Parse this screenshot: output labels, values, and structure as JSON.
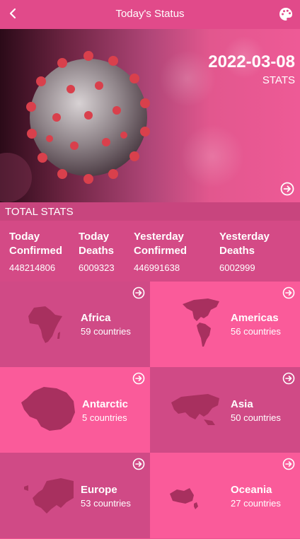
{
  "header": {
    "title": "Today's Status"
  },
  "hero": {
    "date": "2022-03-08",
    "subtitle": "STATS"
  },
  "section": {
    "title": "TOTAL STATS"
  },
  "totals": [
    {
      "label_line1": "Today",
      "label_line2": "Confirmed",
      "value": "448214806"
    },
    {
      "label_line1": "Today",
      "label_line2": "Deaths",
      "value": "6009323"
    },
    {
      "label_line1": "Yesterday",
      "label_line2": "Confirmed",
      "value": "446991638"
    },
    {
      "label_line1": "Yesterday",
      "label_line2": "Deaths",
      "value": "6002999"
    }
  ],
  "continents": [
    {
      "name": "Africa",
      "count": "59 countries"
    },
    {
      "name": "Americas",
      "count": "56 countries"
    },
    {
      "name": "Antarctic",
      "count": "5 countries"
    },
    {
      "name": "Asia",
      "count": "50 countries"
    },
    {
      "name": "Europe",
      "count": "53 countries"
    },
    {
      "name": "Oceania",
      "count": "27 countries"
    }
  ],
  "colors": {
    "appbar": "#e14a8a",
    "tile_dark": "#d04a86",
    "tile_light": "#fa5b9a",
    "map": "#a8305f"
  }
}
